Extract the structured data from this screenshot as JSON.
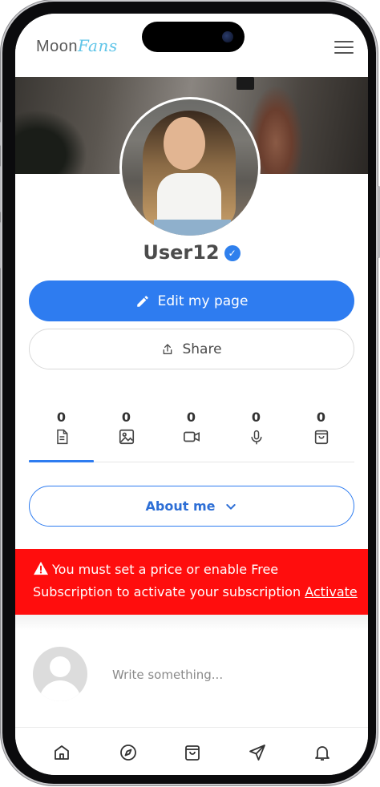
{
  "header": {
    "logo_part1": "Moon",
    "logo_part2": "Fans"
  },
  "profile": {
    "username": "User12",
    "verified_icon": "check-badge-icon"
  },
  "actions": {
    "edit_label": "Edit my page",
    "share_label": "Share"
  },
  "stats": [
    {
      "count": "0",
      "icon": "posts-icon"
    },
    {
      "count": "0",
      "icon": "photos-icon"
    },
    {
      "count": "0",
      "icon": "videos-icon"
    },
    {
      "count": "0",
      "icon": "audio-icon"
    },
    {
      "count": "0",
      "icon": "shop-icon"
    }
  ],
  "about": {
    "label": "About me"
  },
  "alert": {
    "line1": "You must set a price or enable Free",
    "line2": "Subscription to activate your subscription",
    "link": "Activate",
    "background": "#ff0d0d"
  },
  "composer": {
    "placeholder": "Write something..."
  },
  "bottom_nav": [
    "home-icon",
    "explore-icon",
    "shop-icon",
    "messages-icon",
    "notifications-icon"
  ],
  "colors": {
    "accent": "#2e7cf0",
    "alert": "#ff0d0d",
    "logo_accent": "#5ec4e8"
  }
}
